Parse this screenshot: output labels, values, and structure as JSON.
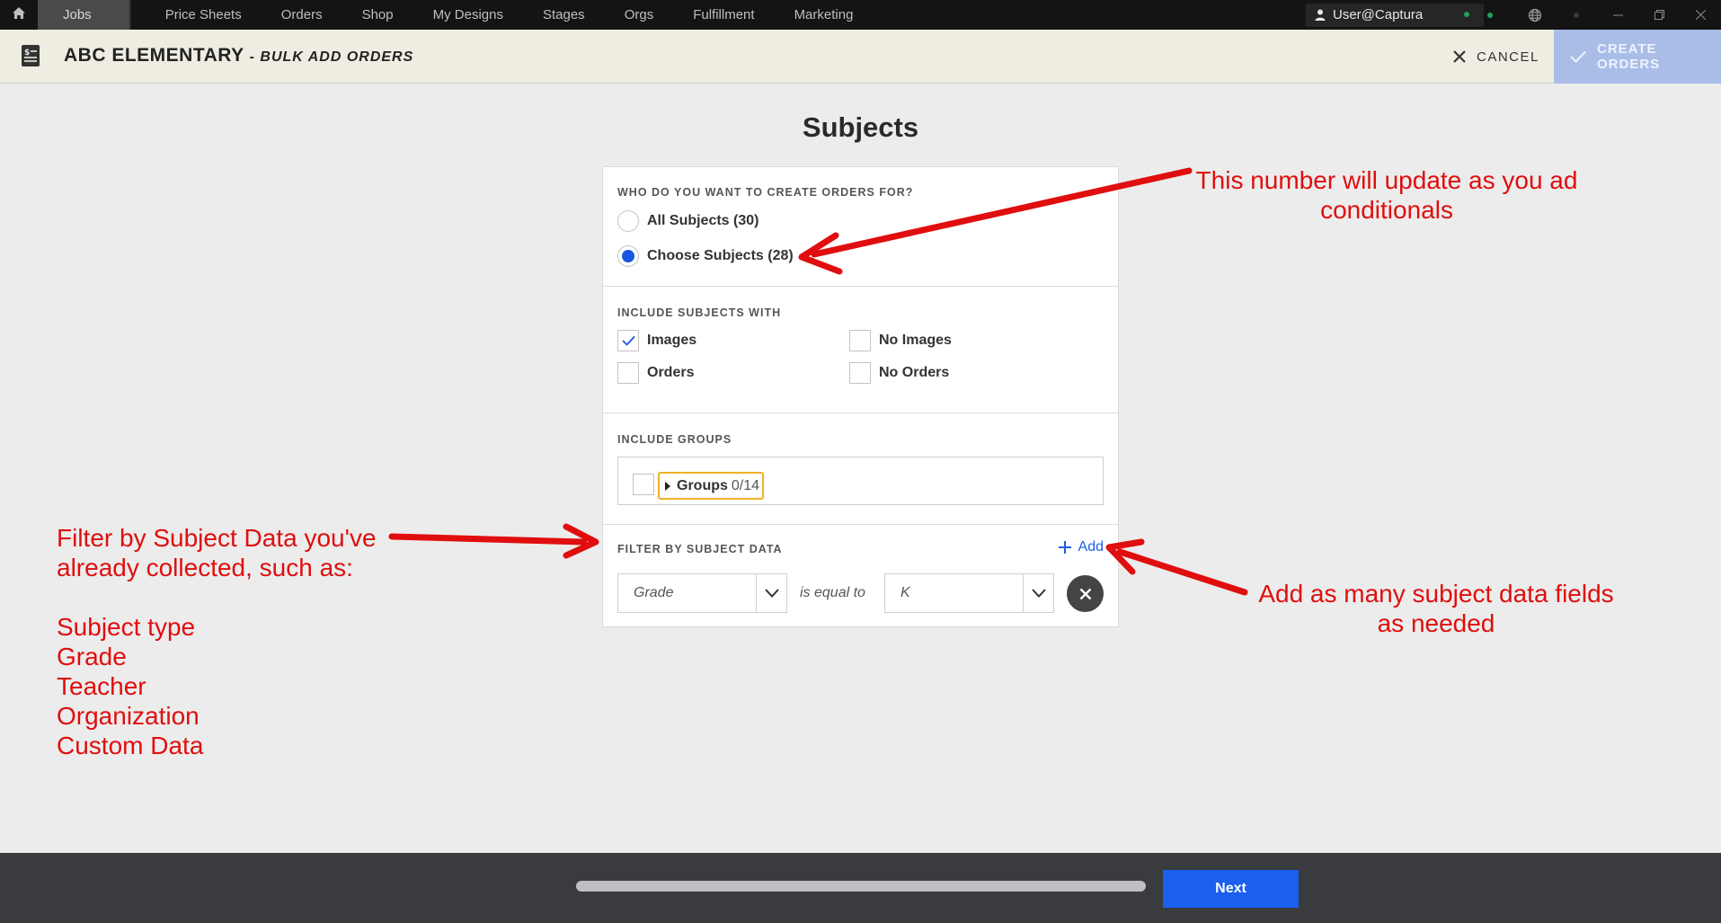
{
  "topnav": {
    "items": [
      {
        "label": "Jobs",
        "active": true
      },
      {
        "label": "Price Sheets"
      },
      {
        "label": "Orders"
      },
      {
        "label": "Shop"
      },
      {
        "label": "My Designs"
      },
      {
        "label": "Stages"
      },
      {
        "label": "Orgs"
      },
      {
        "label": "Fulfillment"
      },
      {
        "label": "Marketing"
      }
    ],
    "user": "User@Captura"
  },
  "header": {
    "title": "ABC ELEMENTARY",
    "subtitle": "- BULK ADD ORDERS",
    "cancel_label": "CANCEL",
    "create_label": "CREATE ORDERS"
  },
  "main": {
    "heading": "Subjects",
    "who": {
      "label": "WHO DO YOU WANT TO CREATE ORDERS FOR?",
      "options": [
        {
          "label": "All Subjects (30)",
          "selected": false
        },
        {
          "label": "Choose Subjects (28)",
          "selected": true
        }
      ]
    },
    "include": {
      "label": "INCLUDE SUBJECTS WITH",
      "images": {
        "label": "Images",
        "checked": true
      },
      "no_images": {
        "label": "No Images",
        "checked": false
      },
      "orders": {
        "label": "Orders",
        "checked": false
      },
      "no_orders": {
        "label": "No Orders",
        "checked": false
      }
    },
    "groups": {
      "label": "INCLUDE GROUPS",
      "tag_label": "Groups",
      "tag_count": "0/14"
    },
    "filter": {
      "label": "FILTER BY SUBJECT DATA",
      "add_label": "Add",
      "field_value": "Grade",
      "operator": "is equal to",
      "match_value": "K"
    }
  },
  "footer": {
    "progress": 1.0,
    "next_label": "Next"
  },
  "annotations": {
    "number_note_line1": "This number will update as you ad",
    "number_note_line2": "conditionals",
    "filter_note_line1": "Filter by Subject Data you've",
    "filter_note_line2": "already collected, such as:",
    "filter_examples": [
      "Subject type",
      "Grade",
      "Teacher",
      "Organization",
      "Custom Data"
    ],
    "add_note_line1": "Add as many subject data fields",
    "add_note_line2": "as needed"
  },
  "colors": {
    "accent": "#1a5ff0",
    "annotation": "#e00e0e",
    "header_bg": "#efede1",
    "create_disabled": "#a9bde6"
  }
}
